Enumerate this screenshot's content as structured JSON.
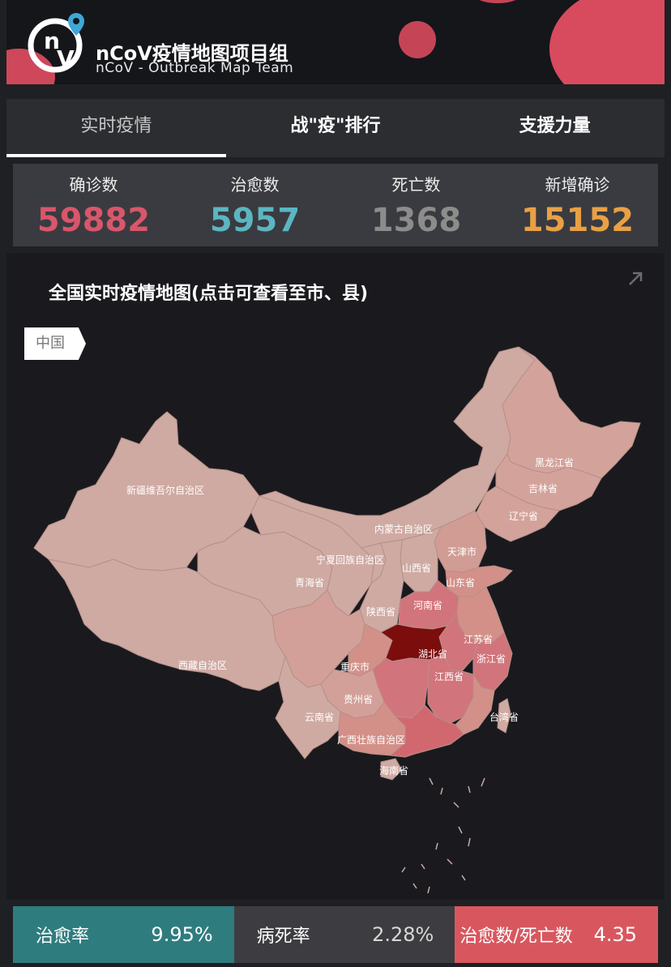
{
  "header": {
    "title": "nCoV疫情地图项目组",
    "subtitle": "nCoV - Outbreak Map Team",
    "logo_text": "nV"
  },
  "tabs": [
    {
      "label": "实时疫情",
      "active": true
    },
    {
      "label": "战\"疫\"排行",
      "active": false
    },
    {
      "label": "支援力量",
      "active": false
    }
  ],
  "stats": [
    {
      "label": "确诊数",
      "value": "59882",
      "color": "#d9566b"
    },
    {
      "label": "治愈数",
      "value": "5957",
      "color": "#5bb6c2"
    },
    {
      "label": "死亡数",
      "value": "1368",
      "color": "#8c8c8c"
    },
    {
      "label": "新增确诊",
      "value": "15152",
      "color": "#e9a045"
    }
  ],
  "map": {
    "title": "全国实时疫情地图(点击可查看至市、县)",
    "breadcrumb": "中国",
    "expand_icon": "expand-arrow-icon",
    "colors": {
      "light": "#cfaaa2",
      "mid": "#d39088",
      "high": "#d26873",
      "hubei": "#7b0d0d",
      "sea": "#1a1a1e"
    },
    "labels": {
      "xinjiang": "新疆维吾尔自治区",
      "xizang": "西藏自治区",
      "qinghai": "青海省",
      "neimenggu": "内蒙古自治区",
      "ningxia": "宁夏回族自治区",
      "heilongjiang": "黑龙江省",
      "jilin": "吉林省",
      "liaoning": "辽宁省",
      "tianjin": "天津市",
      "shanxi": "山西省",
      "shandong": "山东省",
      "shaanxi": "陕西省",
      "henan": "河南省",
      "jiangsu": "江苏省",
      "hubei": "湖北省",
      "zhejiang": "浙江省",
      "chongqing": "重庆市",
      "jiangxi": "江西省",
      "guizhou": "贵州省",
      "yunnan": "云南省",
      "taiwan": "台湾省",
      "guangxi": "广西壮族自治区",
      "hainan": "海南省"
    }
  },
  "footer": [
    {
      "label": "治愈率",
      "value": "9.95%",
      "bg": "#2f7c7f"
    },
    {
      "label": "病死率",
      "value": "2.28%",
      "bg": "#3d3d41"
    },
    {
      "label": "治愈数/死亡数",
      "value": "4.35",
      "bg": "#d8575f"
    }
  ]
}
